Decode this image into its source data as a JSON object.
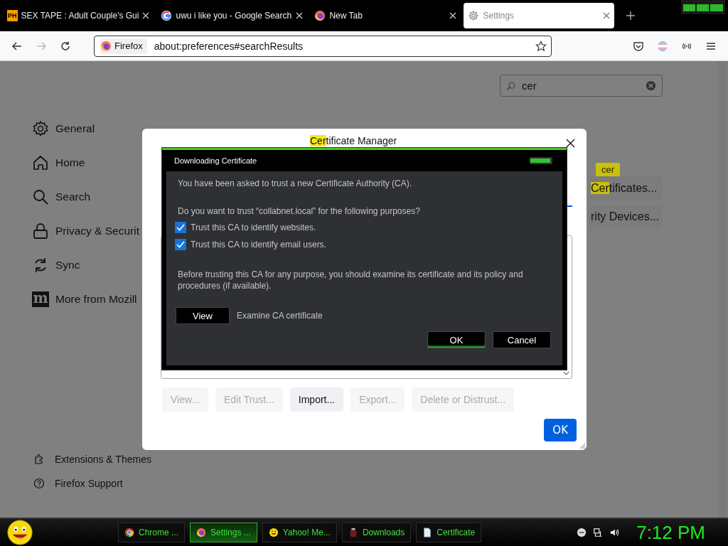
{
  "tabs": [
    {
      "label": "SEX TAPE : Adult Couple's Gui",
      "favicon_text": "PH",
      "selected": false
    },
    {
      "label": "uwu i like you - Google Search",
      "selected": false
    },
    {
      "label": "New Tab",
      "selected": false
    },
    {
      "label": "Settings",
      "selected": true
    }
  ],
  "toolbar": {
    "identity": "Firefox",
    "url": "about:preferences#searchResults"
  },
  "sidebar": {
    "items": [
      {
        "label": "General"
      },
      {
        "label": "Home"
      },
      {
        "label": "Search"
      },
      {
        "label": "Privacy & Securit"
      },
      {
        "label": "Sync"
      },
      {
        "label": "More from Mozill",
        "icon_text": "m"
      }
    ],
    "footer": [
      {
        "label": "Extensions & Themes"
      },
      {
        "label": "Firefox Support"
      }
    ]
  },
  "search": {
    "value": "cer"
  },
  "page_buttons": [
    {
      "highlighted": "Cer",
      "rest": "tificates...",
      "tooltip": "cer"
    },
    {
      "rest": "rity Devices..."
    }
  ],
  "certificate_manager": {
    "title": {
      "highlighted": "Cer",
      "rest": "tificate Manager"
    },
    "buttons": [
      {
        "label": "View...",
        "disabled": true
      },
      {
        "label": "Edit Trust...",
        "disabled": true
      },
      {
        "label": "Import...",
        "disabled": false
      },
      {
        "label": "Export...",
        "disabled": true
      },
      {
        "label": "Delete or Distrust...",
        "disabled": true
      }
    ],
    "ok": "OK"
  },
  "download_dialog": {
    "title": "Downloading Certificate",
    "intro": "You have been asked to trust a new Certificate Authority (CA).",
    "question": "Do you want to trust “collabnet.local” for the following purposes?",
    "options": [
      {
        "label": "Trust this CA to identify websites.",
        "checked": true
      },
      {
        "label": "Trust this CA to identify email users.",
        "checked": true
      }
    ],
    "warning": "Before trusting this CA for any purpose, you should examine its certificate and its policy and procedures (if available).",
    "view_button": "View",
    "view_hint": "Examine CA certificate",
    "ok": "OK",
    "cancel": "Cancel"
  },
  "taskbar": {
    "items": [
      {
        "label": "Chrome ...",
        "selected": false
      },
      {
        "label": "Settings ...",
        "selected": true
      },
      {
        "label": "Yahoo! Me...",
        "selected": false
      },
      {
        "label": "Downloads",
        "selected": false
      },
      {
        "label": "Certificate",
        "selected": false
      }
    ],
    "clock": "7:12 PM"
  }
}
